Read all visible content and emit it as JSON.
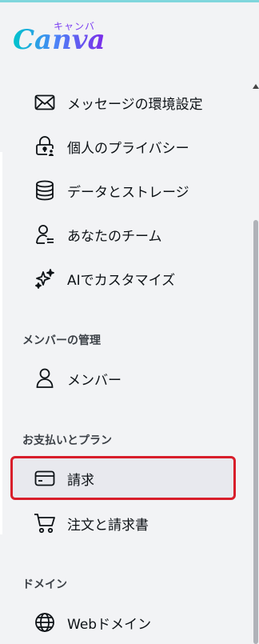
{
  "logo": {
    "wordmark": "Canva",
    "kana": "キャンバ"
  },
  "menu": [
    {
      "label": "メッセージの環境設定",
      "icon": "envelope-icon"
    },
    {
      "label": "個人のプライバシー",
      "icon": "lock-person-icon"
    },
    {
      "label": "データとストレージ",
      "icon": "database-icon"
    },
    {
      "label": "あなたのチーム",
      "icon": "team-icon"
    },
    {
      "label": "AIでカスタマイズ",
      "icon": "sparkles-icon"
    }
  ],
  "sections": {
    "members": {
      "title": "メンバーの管理",
      "items": [
        {
          "label": "メンバー",
          "icon": "person-icon"
        }
      ]
    },
    "billing": {
      "title": "お支払いとプラン",
      "items": [
        {
          "label": "請求",
          "icon": "credit-card-icon",
          "selected": true
        },
        {
          "label": "注文と請求書",
          "icon": "shopping-cart-icon"
        }
      ]
    },
    "domains": {
      "title": "ドメイン",
      "items": [
        {
          "label": "Webドメイン",
          "icon": "globe-icon"
        }
      ]
    }
  },
  "colors": {
    "selection_outline": "#d81e2a",
    "selected_bg": "#e8e9ee",
    "brand_gradient": [
      "#00c4cc",
      "#7d2ae8"
    ]
  }
}
